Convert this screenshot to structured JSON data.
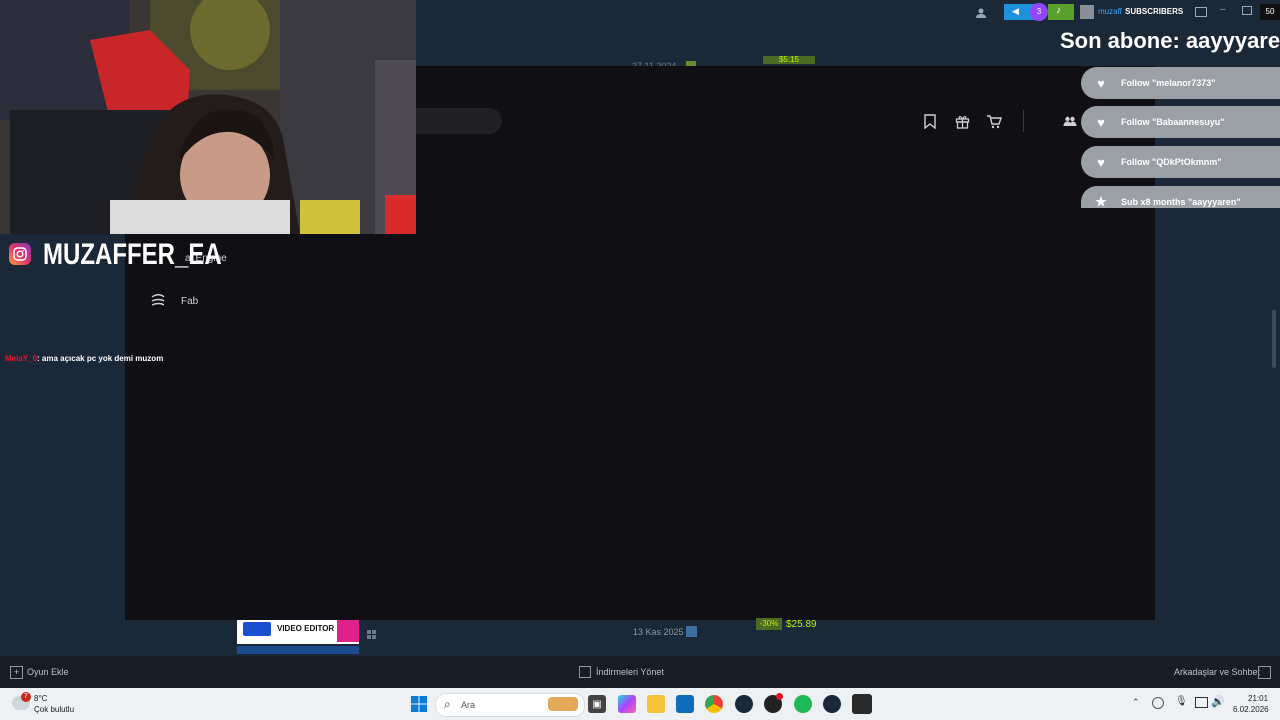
{
  "webcam_overlay": {
    "instagram_handle": "MUZAFFER_EA",
    "chat": {
      "user": "MelaY_0",
      "message": ": ama açıcak pc yok demi muzom"
    }
  },
  "stream_overlay": {
    "bar": {
      "badge_count": "3",
      "channel": "muzaff",
      "subscribers_label": "SUBSCRIBERS",
      "viewer_count": "50"
    },
    "last_sub": "Son abone: aayyyaren",
    "alerts": [
      {
        "text": "Follow \"melanor7373\""
      },
      {
        "text": "Follow \"Babaannesuyu\""
      },
      {
        "text": "Follow \"QDkPtOkmnm\""
      },
      {
        "text": "Sub x8 months \"aayyyaren\""
      }
    ]
  },
  "epic_launcher": {
    "nav": {
      "unreal_engine": "al Engine",
      "fab": "Fab"
    }
  },
  "steam": {
    "bg_date_top": "27.11.2024",
    "bg_price_top": "$5.15",
    "game_thumb_label": "VIDEO EDITOR",
    "bottom_date": "13 Kas 2025",
    "bottom_discount": "-30%",
    "bottom_price": "$25.89",
    "footer": {
      "add_game": "Oyun Ekle",
      "manage_downloads": "İndirmeleri Yönet",
      "friends_chat": "Arkadaşlar ve Sohbet"
    }
  },
  "taskbar": {
    "weather": {
      "temp": "8°C",
      "condition": "Çok bulutlu",
      "badge": "7"
    },
    "search_placeholder": "Ara",
    "time": "21:01",
    "date": "6.02.2026"
  },
  "colors": {
    "steam_bg": "#1b2838",
    "epic_bg": "#101014",
    "price_green": "#beee11",
    "chat_user": "#e8112d"
  }
}
